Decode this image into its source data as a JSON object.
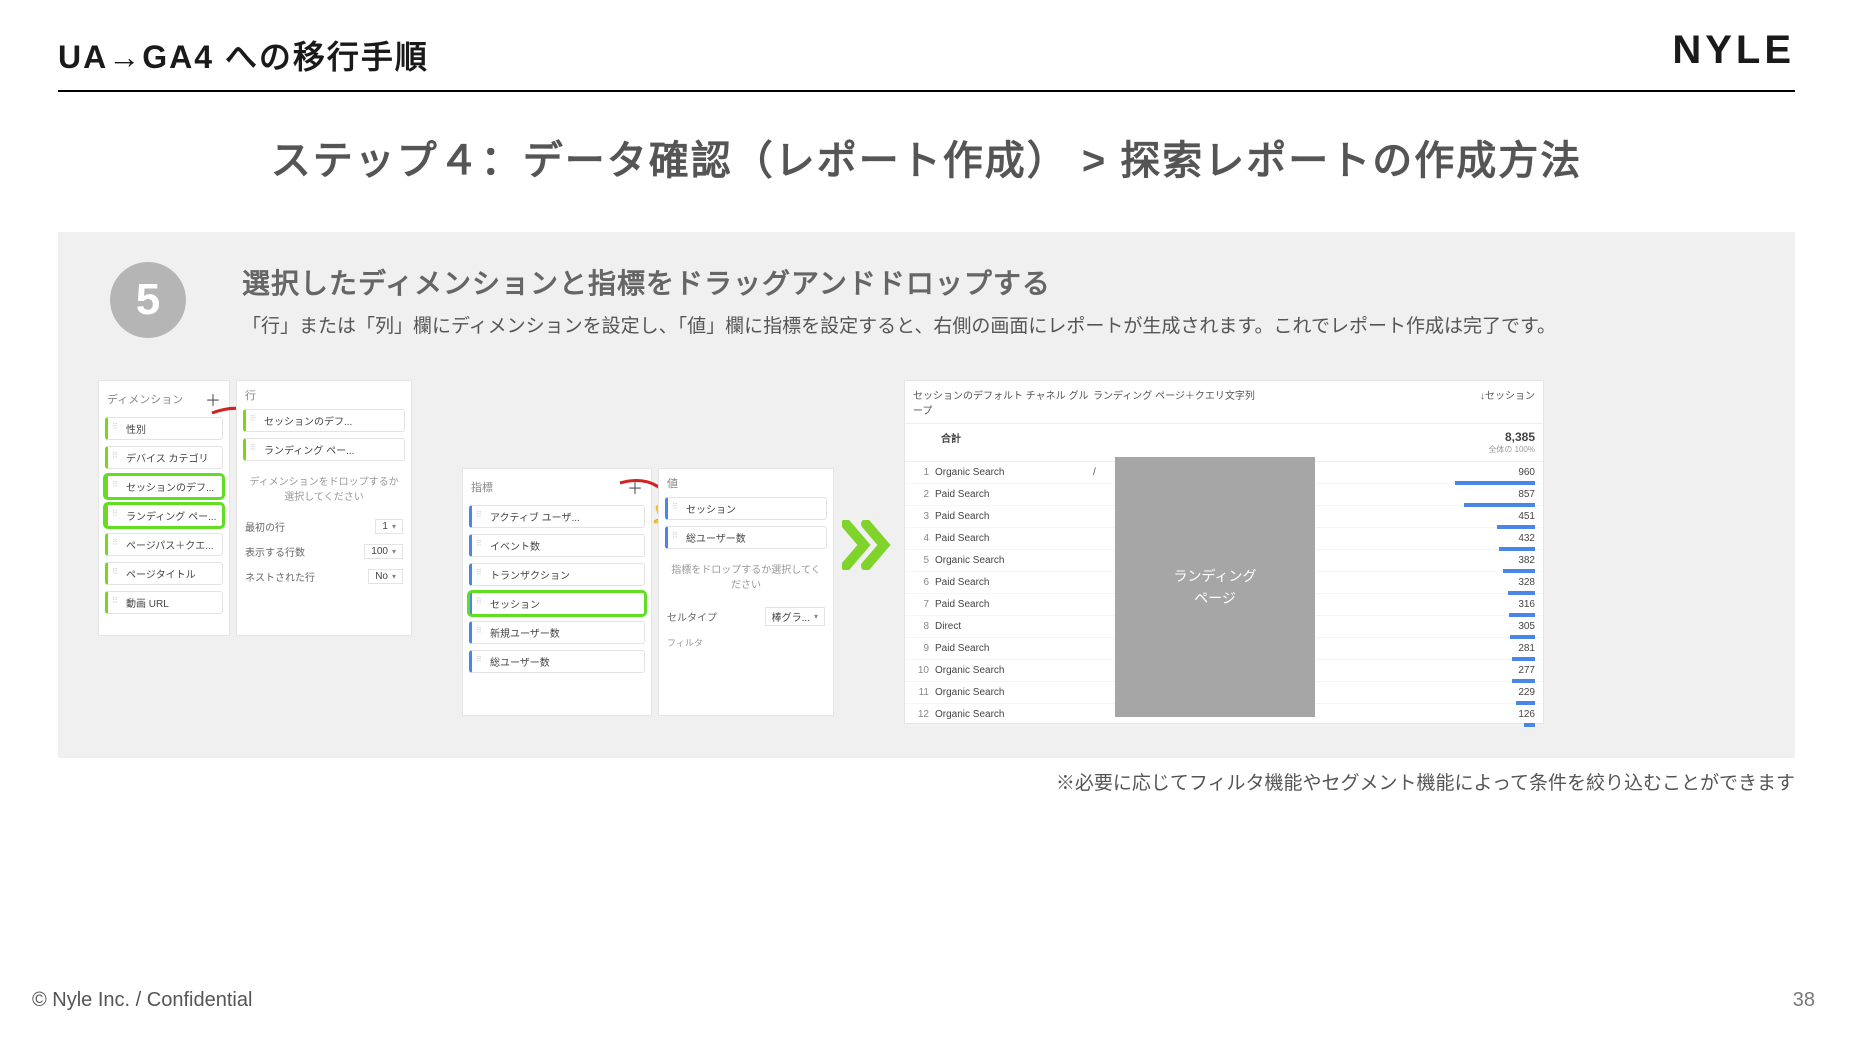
{
  "header": {
    "title": "UA→GA4 への移行手順",
    "logo": "NYLE"
  },
  "main_title": "ステップ４：データ確認（レポート作成） > 探索レポートの作成方法",
  "step": {
    "number": "5",
    "heading": "選択したディメンションと指標をドラッグアンドドロップする",
    "body": "「行」または「列」欄にディメンションを設定し、「値」欄に指標を設定すると、右側の画面にレポートが生成されます。これでレポート作成は完了です。"
  },
  "panelA": {
    "title": "ディメンション",
    "items": [
      "性別",
      "デバイス カテゴリ",
      "セッションのデフ...",
      "ランディング ペー...",
      "ページパス＋クエ...",
      "ページタイトル",
      "動画 URL"
    ]
  },
  "panelB": {
    "title": "行",
    "items": [
      "セッションのデフ...",
      "ランディング ペー..."
    ],
    "drop_hint": "ディメンションをドロップするか選択してください",
    "cfg": [
      {
        "label": "最初の行",
        "value": "1"
      },
      {
        "label": "表示する行数",
        "value": "100"
      },
      {
        "label": "ネストされた行",
        "value": "No"
      }
    ]
  },
  "panelC": {
    "title": "指標",
    "items": [
      "アクティブ ユーザ...",
      "イベント数",
      "トランザクション",
      "セッション",
      "新規ユーザー数",
      "総ユーザー数"
    ]
  },
  "panelD": {
    "title": "値",
    "items": [
      "セッション",
      "総ユーザー数"
    ],
    "drop_hint": "指標をドロップするか選択してください",
    "cell_type_label": "セルタイプ",
    "cell_type_value": "棒グラ...",
    "filter_label": "フィルタ"
  },
  "table": {
    "col1": "セッションのデフォルト チャネル グループ",
    "col2": "ランディング ページ＋クエリ文字列",
    "col3": "↓セッション",
    "total_label": "合計",
    "total_value": "8,385",
    "total_sub": "全体の 100%",
    "lp_blob": "ランディング\nページ",
    "rows": [
      {
        "n": "1",
        "ch": "Organic Search",
        "lp": "/",
        "v": "960"
      },
      {
        "n": "2",
        "ch": "Paid Search",
        "lp": "",
        "v": "857"
      },
      {
        "n": "3",
        "ch": "Paid Search",
        "lp": "",
        "v": "451"
      },
      {
        "n": "4",
        "ch": "Paid Search",
        "lp": "",
        "v": "432"
      },
      {
        "n": "5",
        "ch": "Organic Search",
        "lp": "",
        "v": "382"
      },
      {
        "n": "6",
        "ch": "Paid Search",
        "lp": "",
        "v": "328"
      },
      {
        "n": "7",
        "ch": "Paid Search",
        "lp": "",
        "v": "316"
      },
      {
        "n": "8",
        "ch": "Direct",
        "lp": "",
        "v": "305"
      },
      {
        "n": "9",
        "ch": "Paid Search",
        "lp": "",
        "v": "281"
      },
      {
        "n": "10",
        "ch": "Organic Search",
        "lp": "",
        "v": "277"
      },
      {
        "n": "11",
        "ch": "Organic Search",
        "lp": "",
        "v": "229"
      },
      {
        "n": "12",
        "ch": "Organic Search",
        "lp": "",
        "v": "126"
      }
    ]
  },
  "note": "※必要に応じてフィルタ機能やセグメント機能によって条件を絞り込むことができます",
  "footer": {
    "left": "© Nyle Inc. / Confidential",
    "page": "38"
  },
  "chart_data": {
    "type": "bar",
    "title": "↓セッション",
    "xlabel": "セッションのデフォルト チャネル グループ / ランディング ページ＋クエリ文字列",
    "ylabel": "セッション",
    "total": 8385,
    "categories": [
      "Organic Search",
      "Paid Search",
      "Paid Search",
      "Paid Search",
      "Organic Search",
      "Paid Search",
      "Paid Search",
      "Direct",
      "Paid Search",
      "Organic Search",
      "Organic Search",
      "Organic Search"
    ],
    "values": [
      960,
      857,
      451,
      432,
      382,
      328,
      316,
      305,
      281,
      277,
      229,
      126
    ]
  }
}
